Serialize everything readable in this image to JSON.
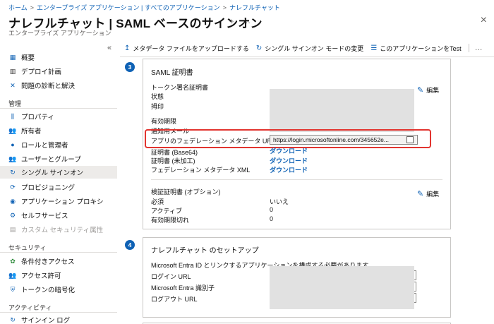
{
  "breadcrumb": {
    "home": "ホーム",
    "enterprise_apps": "エンタープライズ アプリケーション | すべてのアプリケーション",
    "app": "ナレフルチャット",
    "separator": ">"
  },
  "header": {
    "title": "ナレフルチャット | SAML ベースのサインオン",
    "subtitle": "エンタープライズ アプリケーション",
    "more": "…",
    "close": "×"
  },
  "sidebar": {
    "collapse": "«",
    "top_items": [
      {
        "label": "概要",
        "icon": "grid-icon"
      },
      {
        "label": "デプロイ計画",
        "icon": "book-icon"
      },
      {
        "label": "問題の診断と解決",
        "icon": "wrench-icon"
      }
    ],
    "sections": [
      {
        "title": "管理"
      },
      {
        "title": "セキュリティ"
      },
      {
        "title": "アクティビティ"
      }
    ],
    "manage_items": [
      {
        "label": "プロパティ",
        "icon": "properties-icon"
      },
      {
        "label": "所有者",
        "icon": "owners-icon"
      },
      {
        "label": "ロールと管理者",
        "icon": "roles-icon"
      },
      {
        "label": "ユーザーとグループ",
        "icon": "users-groups-icon"
      },
      {
        "label": "シングル サインオン",
        "icon": "sso-icon"
      },
      {
        "label": "プロビジョニング",
        "icon": "provisioning-icon"
      },
      {
        "label": "アプリケーション プロキシ",
        "icon": "proxy-icon"
      },
      {
        "label": "セルフサービス",
        "icon": "self-service-icon"
      },
      {
        "label": "カスタム セキュリティ属性",
        "icon": "custom-attr-icon"
      }
    ],
    "security_items": [
      {
        "label": "条件付きアクセス",
        "icon": "conditional-access-icon"
      },
      {
        "label": "アクセス許可",
        "icon": "permissions-icon"
      },
      {
        "label": "トークンの暗号化",
        "icon": "token-encryption-icon"
      }
    ],
    "activity_items": [
      {
        "label": "サインイン ログ",
        "icon": "signin-logs-icon"
      }
    ]
  },
  "toolbar": {
    "upload": "メタデータ ファイルをアップロードする",
    "change_mode": "シングル サインオン モードの変更",
    "test": "このアプリケーションをTest",
    "more": "…"
  },
  "saml_card": {
    "step": "3",
    "title": "SAML 証明書",
    "edit": "編集",
    "token_cert_heading": "トークン署名証明書",
    "status": "状態",
    "thumbprint": "拇印",
    "expiry": "有効期限",
    "notify_email": "通知用メール",
    "metadata_url_label": "アプリのフェデレーション メタデータ URL",
    "metadata_url_value": "https://login.microsoftonline.com/345652e...",
    "cert_base64": "証明書 (Base64)",
    "cert_raw": "証明書 (未加工)",
    "federation_xml": "フェデレーション メタデータ XML",
    "download": "ダウンロード",
    "verify_heading": "検証証明書 (オプション)",
    "required": "必須",
    "required_value": "いいえ",
    "active": "アクティブ",
    "active_value": "0",
    "expired": "有効期限切れ",
    "expired_value": "0"
  },
  "setup_card": {
    "step": "4",
    "title": "ナレフルチャット のセットアップ",
    "description": "Microsoft Entra ID とリンクするアプリケーションを構成する必要があります。",
    "login_url": "ログイン URL",
    "entra_id": "Microsoft Entra 識別子",
    "logout_url": "ログアウト URL"
  },
  "colors": {
    "accent": "#0f62b5",
    "highlight": "#e2342f"
  }
}
